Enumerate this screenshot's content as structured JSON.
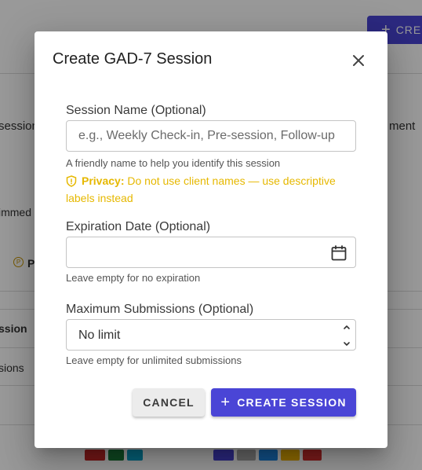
{
  "background": {
    "create_button_label": "CRE",
    "fragments": {
      "session_left": "session",
      "ment_right": "ment",
      "immed_left": "immed",
      "p_label": "P",
      "ssion_row": "ssion",
      "sions_row": "sions"
    }
  },
  "dialog": {
    "title": "Create GAD-7 Session",
    "close_icon": "close-icon",
    "session_name": {
      "label": "Session Name (Optional)",
      "placeholder": "e.g., Weekly Check-in, Pre-session, Follow-up",
      "value": "",
      "helper": "A friendly name to help you identify this session",
      "privacy_label": "Privacy:",
      "privacy_text": "Do not use client names — use descriptive labels instead"
    },
    "expiration_date": {
      "label": "Expiration Date (Optional)",
      "value": "",
      "icon": "calendar-icon",
      "helper": "Leave empty for no expiration"
    },
    "max_submissions": {
      "label": "Maximum Submissions (Optional)",
      "value": "No limit",
      "helper": "Leave empty for unlimited submissions"
    },
    "cancel_label": "CANCEL",
    "create_label": "CREATE SESSION"
  },
  "colors": {
    "primary": "#4a45d6",
    "warning": "#e6b800",
    "overlay": "rgba(0,0,0,0.40)"
  }
}
